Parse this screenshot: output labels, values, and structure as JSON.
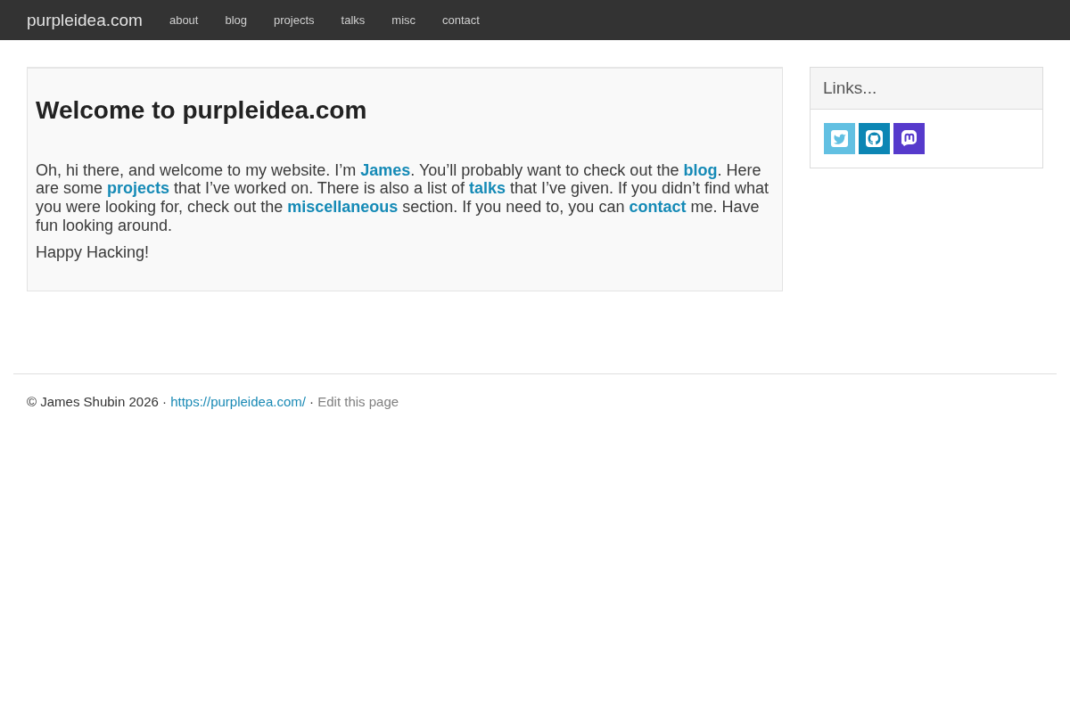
{
  "navbar": {
    "brand": "purpleidea.com",
    "items": [
      "about",
      "blog",
      "projects",
      "talks",
      "misc",
      "contact"
    ]
  },
  "main": {
    "title": "Welcome to purpleidea.com",
    "paragraphs": [
      [
        {
          "kind": "text",
          "text": "Oh, hi there, and welcome to my website. I’m "
        },
        {
          "kind": "link",
          "text": "James"
        },
        {
          "kind": "text",
          "text": ". You’ll probably want to check out the "
        },
        {
          "kind": "link",
          "text": "blog"
        },
        {
          "kind": "text",
          "text": ". Here are some "
        },
        {
          "kind": "link",
          "text": "projects"
        },
        {
          "kind": "text",
          "text": " that I’ve worked on. There is also a list of "
        },
        {
          "kind": "link",
          "text": "talks"
        },
        {
          "kind": "text",
          "text": " that I’ve given. If you didn’t find what you were looking for, check out the "
        },
        {
          "kind": "link",
          "text": "miscellaneous"
        },
        {
          "kind": "text",
          "text": " section. If you need to, you can "
        },
        {
          "kind": "link",
          "text": "contact"
        },
        {
          "kind": "text",
          "text": " me. Have fun looking around."
        }
      ],
      [
        {
          "kind": "text",
          "text": "Happy Hacking!"
        }
      ]
    ]
  },
  "sidebar": {
    "title": "Links..."
  },
  "footer": {
    "segments": [
      {
        "kind": "text",
        "text": "© James Shubin 2026 · "
      },
      {
        "kind": "link",
        "text": "https://purpleidea.com/"
      },
      {
        "kind": "text",
        "text": " · "
      },
      {
        "kind": "muted-link",
        "text": "Edit this page"
      }
    ]
  }
}
